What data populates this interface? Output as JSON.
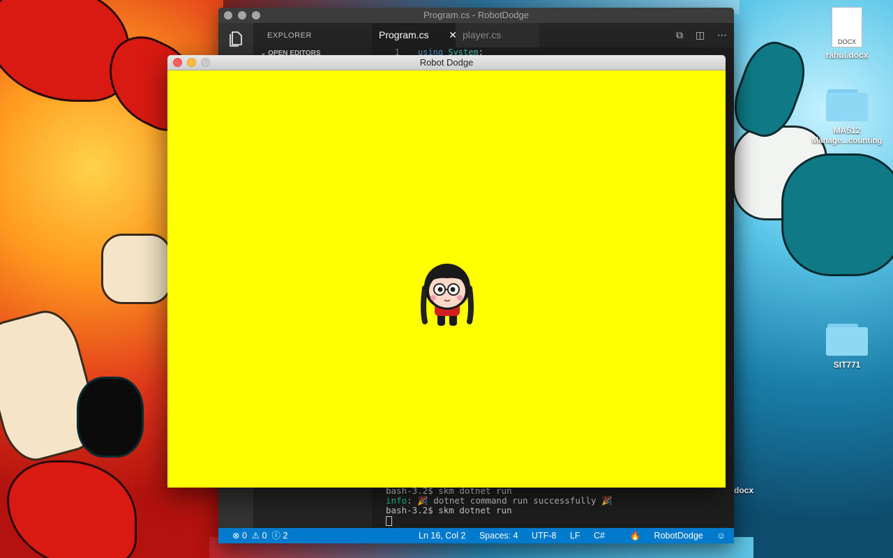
{
  "desktop": {
    "icons": [
      {
        "label": "rahul.docx",
        "type": "document",
        "badge": "DOCX"
      },
      {
        "label_line1": "MA512",
        "label_line2": "Manage...counting",
        "type": "folder"
      },
      {
        "label": "SIT771",
        "type": "folder"
      }
    ],
    "partial_label": "docx"
  },
  "vscode": {
    "title": "Program.cs - RobotDodge",
    "sidebar_title": "EXPLORER",
    "sidebar_section": "OPEN EDITORS",
    "tabs": [
      {
        "label": "Program.cs",
        "active": true
      },
      {
        "label": "player.cs",
        "active": false
      }
    ],
    "code_line": {
      "number": "1",
      "keyword": "using",
      "namespace": "System",
      "terminator": ";"
    },
    "terminal": {
      "line1": "bash-3.2$ skm dotnet run",
      "line2_prefix": "info",
      "line2_text": ": 🎉  dotnet command run successfully 🎉",
      "line3": "bash-3.2$ skm dotnet run"
    },
    "statusbar": {
      "errors": "0",
      "warnings": "0",
      "infos": "2",
      "position": "Ln 16, Col 2",
      "spaces": "Spaces: 4",
      "encoding": "UTF-8",
      "eol": "LF",
      "language": "C#",
      "project": "RobotDodge"
    },
    "colors": {
      "statusbar": "#007acc",
      "editor_bg": "#1e1e1e"
    }
  },
  "game": {
    "title": "Robot Dodge",
    "background": "#ffff00",
    "sprite": "player-girl-sprite"
  }
}
